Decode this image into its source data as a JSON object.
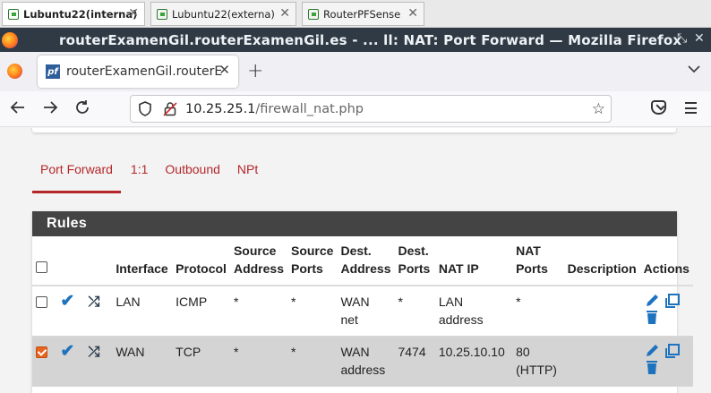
{
  "vm_tabs": [
    {
      "label": "Lubuntu22(interna)",
      "active": true
    },
    {
      "label": "Lubuntu22(externa)",
      "active": false
    },
    {
      "label": "RouterPFSense",
      "active": false
    }
  ],
  "window": {
    "title": "routerExamenGil.routerExamenGil.es - ... ll: NAT: Port Forward — Mozilla Firefox",
    "controls": [
      "minimize",
      "restore",
      "close"
    ]
  },
  "browser_tab": {
    "title": "routerExamenGil.routerE",
    "favicon": "pf",
    "new_tab_symbol": "+",
    "list_symbol": "⌄"
  },
  "navigation": {
    "url_host": "10.25.25.1",
    "url_path": "/firewall_nat.php"
  },
  "nat_tabs": [
    {
      "label": "Port Forward",
      "active": true
    },
    {
      "label": "1:1",
      "active": false
    },
    {
      "label": "Outbound",
      "active": false
    },
    {
      "label": "NPt",
      "active": false
    }
  ],
  "rules": {
    "heading": "Rules",
    "columns": [
      {
        "line1": "",
        "line2": ""
      },
      {
        "line1": "",
        "line2": ""
      },
      {
        "line1": "",
        "line2": ""
      },
      {
        "line1": "",
        "line2": "Interface"
      },
      {
        "line1": "",
        "line2": "Protocol"
      },
      {
        "line1": "Source",
        "line2": "Address"
      },
      {
        "line1": "Source",
        "line2": "Ports"
      },
      {
        "line1": "Dest.",
        "line2": "Address"
      },
      {
        "line1": "Dest.",
        "line2": "Ports"
      },
      {
        "line1": "",
        "line2": "NAT IP"
      },
      {
        "line1": "NAT",
        "line2": "Ports"
      },
      {
        "line1": "",
        "line2": "Description"
      },
      {
        "line1": "",
        "line2": "Actions"
      }
    ],
    "rows": [
      {
        "checked": false,
        "interface": "LAN",
        "protocol": "ICMP",
        "source_address": "*",
        "source_ports": "*",
        "dest_address_1": "WAN",
        "dest_address_2": "net",
        "dest_ports": "*",
        "nat_ip_1": "LAN",
        "nat_ip_2": "address",
        "nat_ports_1": "*",
        "nat_ports_2": "",
        "description": ""
      },
      {
        "checked": true,
        "interface": "WAN",
        "protocol": "TCP",
        "source_address": "*",
        "source_ports": "*",
        "dest_address_1": "WAN",
        "dest_address_2": "address",
        "dest_ports": "7474",
        "nat_ip_1": "10.25.10.10",
        "nat_ip_2": "",
        "nat_ports_1": "80",
        "nat_ports_2": "(HTTP)",
        "description": ""
      }
    ]
  },
  "colors": {
    "accent": "#b5262a",
    "panel_header": "#444444",
    "action_blue": "#1e73be",
    "checkbox_orange": "#e8631d",
    "titlebar": "#2f3a45"
  }
}
